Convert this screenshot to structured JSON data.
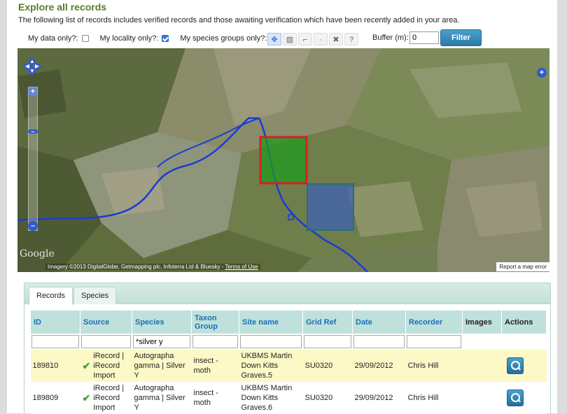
{
  "page": {
    "title": "Explore all records",
    "intro": "The following list of records includes verified records and those awaiting verification which have been recently added in your area."
  },
  "filters": {
    "my_data_label": "My data only?:",
    "my_data_checked": false,
    "my_locality_label": "My locality only?:",
    "my_locality_checked": true,
    "my_species_label": "My species groups only?:",
    "my_species_checked": false,
    "buffer_label": "Buffer (m):",
    "buffer_value": "0",
    "filter_button": "Filter"
  },
  "map_tools": [
    "pan-tool-icon",
    "box-select-icon",
    "line-draw-icon",
    "point-draw-icon",
    "clear-icon",
    "help-icon"
  ],
  "map": {
    "google_logo": "Google",
    "attribution": "Imagery ©2013 DigitalGlobe, Getmapping plc, Infoterra Ltd & Bluesky - ",
    "terms_link": "Terms of Use",
    "report_link": "Report a map error",
    "colors": {
      "green_square": "#1f9a1f",
      "red_border": "#d42020",
      "blue_square": "#3a5fb8",
      "river": "#1a3bd6"
    }
  },
  "tabs": [
    "Records",
    "Species"
  ],
  "grid": {
    "headers": [
      "ID",
      "Source",
      "Species",
      "Taxon Group",
      "Site name",
      "Grid Ref",
      "Date",
      "Recorder",
      "Images",
      "Actions"
    ],
    "species_filter": "*silver y",
    "rows": [
      {
        "id": "189810",
        "source": "iRecord | iRecord Import",
        "species": "Autographa gamma | Silver Y",
        "taxon_group": "insect - moth",
        "site_name": "UKBMS Martin Down Kitts Graves.5",
        "grid_ref": "SU0320",
        "date": "29/09/2012",
        "recorder": "Chris Hill"
      },
      {
        "id": "189809",
        "source": "iRecord | iRecord Import",
        "species": "Autographa gamma | Silver Y",
        "taxon_group": "insect - moth",
        "site_name": "UKBMS Martin Down Kitts Graves.6",
        "grid_ref": "SU0320",
        "date": "29/09/2012",
        "recorder": "Chris Hill"
      }
    ]
  }
}
